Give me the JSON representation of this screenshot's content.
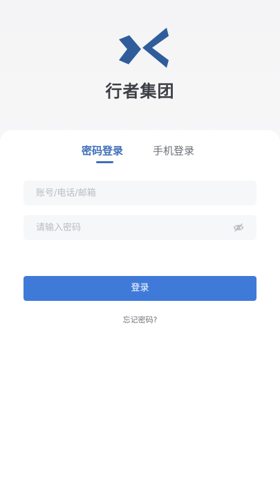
{
  "brand": {
    "name": "行者集团",
    "logo_icon": "chevron-cross-logo-icon",
    "logo_color": "#2f5d9c"
  },
  "tabs": [
    {
      "label": "密码登录",
      "active": true
    },
    {
      "label": "手机登录",
      "active": false
    }
  ],
  "form": {
    "account_placeholder": "账号/电话/邮箱",
    "account_value": "",
    "password_placeholder": "请输入密码",
    "password_value": "",
    "password_toggle_icon": "eye-hidden-icon"
  },
  "actions": {
    "login_label": "登录",
    "forgot_label": "忘记密码?"
  },
  "colors": {
    "accent": "#3f6fb8",
    "button": "#3f7ad9"
  }
}
